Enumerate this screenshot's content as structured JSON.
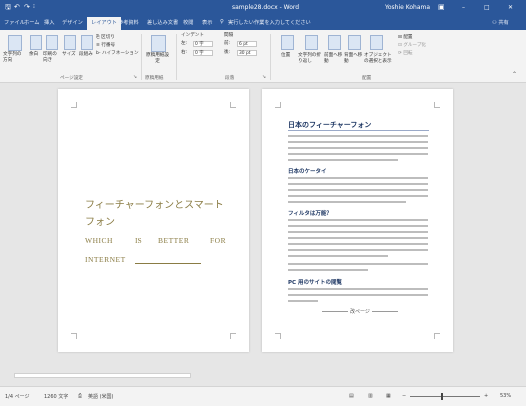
{
  "window": {
    "title": "sample28.docx - Word",
    "user": "Yoshie Kohama",
    "quick_access": [
      "save-icon",
      "undo-icon",
      "redo-icon"
    ],
    "controls": {
      "minimize": "–",
      "maximize": "□",
      "close": "✕"
    }
  },
  "tabs": [
    "ファイル",
    "ホーム",
    "挿入",
    "デザイン",
    "レイアウト",
    "参考資料",
    "差し込み文書",
    "校閲",
    "表示"
  ],
  "active_tab": "レイアウト",
  "tell_me": "実行したい作業を入力してください",
  "share": "共有",
  "ribbon": {
    "page_setup": {
      "buttons": [
        "文字列の方向",
        "余白",
        "印刷の向き",
        "サイズ",
        "段組み"
      ],
      "small": [
        "区切り",
        "行番号",
        "ハイフネーション"
      ],
      "label": "ページ設定"
    },
    "genkou": {
      "button": "原稿用紙設定",
      "label": "原稿用紙"
    },
    "paragraph": {
      "indent_label": "インデント",
      "spacing_label": "間隔",
      "left": "左:",
      "left_val": "0 字",
      "right": "右:",
      "right_val": "0 字",
      "before": "前:",
      "before_val": "6 pt",
      "after": "後:",
      "after_val": "30 pt",
      "label": "段落"
    },
    "arrange": {
      "buttons": [
        "位置",
        "文字列の折り返し",
        "前面へ移動",
        "背面へ移動",
        "オブジェクトの選択と表示"
      ],
      "small": [
        "配置",
        "グループ化",
        "回転"
      ],
      "label": "配置"
    }
  },
  "page1": {
    "title_line1": "フィーチャーフォンとスマート",
    "title_line2": "フォン",
    "subtitle_w1": "WHICH",
    "subtitle_w2": "IS",
    "subtitle_w3": "BETTER",
    "subtitle_w4": "FOR",
    "subtitle_line2": "INTERNET"
  },
  "page2": {
    "heading": "日本のフィーチャーフォン",
    "sub1": "日本のケータイ",
    "sub2": "フィルタは万能？",
    "sub3": "PC 用のサイトの閲覧",
    "pagebreak": "改ページ"
  },
  "status": {
    "page": "1/4 ページ",
    "words": "1260 文字",
    "language": "英語 (米国)",
    "zoom": "53%"
  },
  "colors": {
    "accent": "#2b579a",
    "title_text": "#8a7c44",
    "heading_text": "#1f3864"
  }
}
